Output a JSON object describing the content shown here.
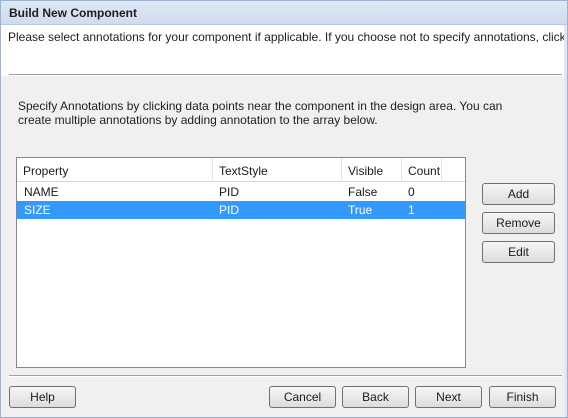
{
  "window": {
    "title": "Build New Component"
  },
  "header": {
    "instruction": "Please select annotations for your component if applicable.  If you choose not to specify annotations, click Next"
  },
  "description": "Specify Annotations by clicking data points near the component in the design area.  You can create multiple annotations by adding annotation to the array below.",
  "grid": {
    "columns": [
      "Property",
      "TextStyle",
      "Visible",
      "Count"
    ],
    "rows": [
      {
        "property": "NAME",
        "text_style": "PID",
        "visible": "False",
        "count": "0",
        "selected": false
      },
      {
        "property": "SIZE",
        "text_style": "PID",
        "visible": "True",
        "count": "1",
        "selected": true
      }
    ],
    "selection_color": "#3399ff"
  },
  "side_buttons": {
    "add": "Add",
    "remove": "Remove",
    "edit": "Edit"
  },
  "footer_buttons": {
    "help": "Help",
    "cancel": "Cancel",
    "back": "Back",
    "next": "Next",
    "finish": "Finish"
  }
}
